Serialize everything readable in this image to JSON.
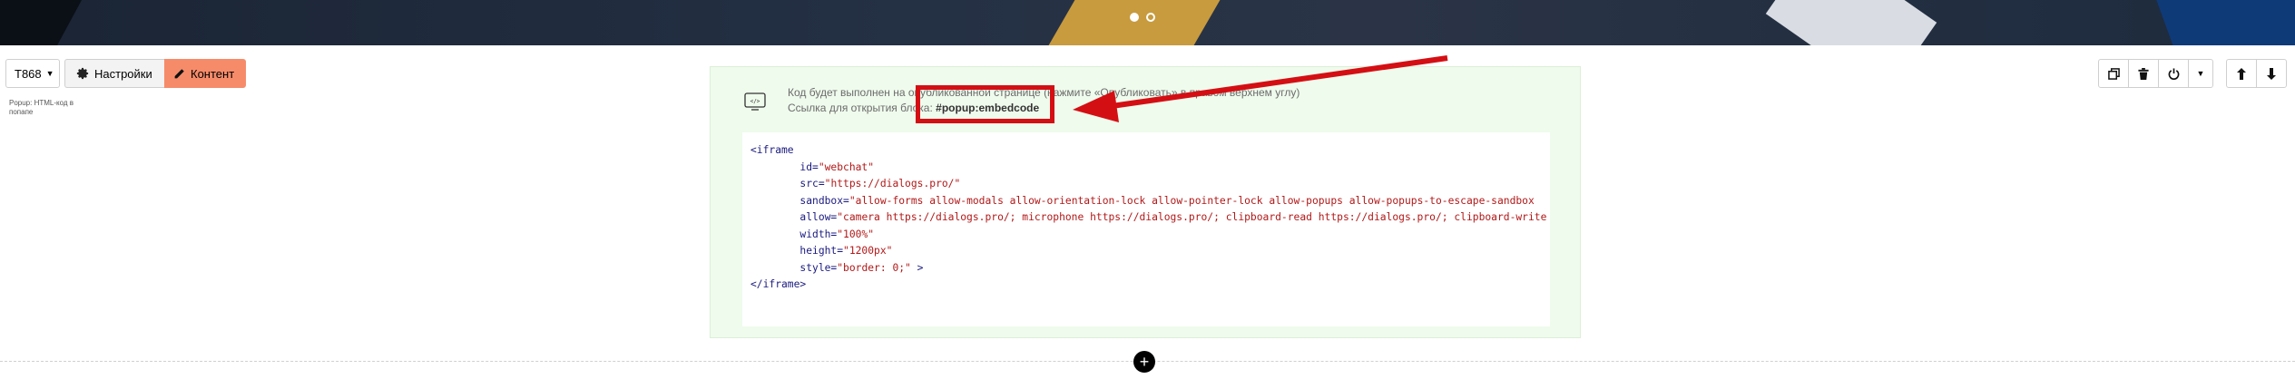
{
  "banner": {
    "slides": [
      {
        "state": "active"
      },
      {
        "state": "inactive"
      }
    ]
  },
  "toolbar": {
    "block_id": "T868",
    "settings_label": "Настройки",
    "content_label": "Контент",
    "block_description": "Popup: HTML-код в попапе"
  },
  "block": {
    "info_line1": "Код будет выполнен на опубликованной странице (нажмите «Опубликовать» в правом верхнем углу)",
    "info_link_label": "Ссылка для открытия блока:",
    "info_link_code": "#popup:embedcode"
  },
  "code": {
    "open_tag": "<iframe",
    "lines": [
      {
        "attr": "id=",
        "val": "\"webchat\""
      },
      {
        "attr": "src=",
        "val": "\"https://dialogs.pro/\""
      },
      {
        "attr": "sandbox=",
        "val": "\"allow-forms allow-modals allow-orientation-lock allow-pointer-lock allow-popups allow-popups-to-escape-sandbox"
      },
      {
        "attr": "allow=",
        "val": "\"camera https://dialogs.pro/; microphone https://dialogs.pro/; clipboard-read https://dialogs.pro/; clipboard-write"
      },
      {
        "attr": "width=",
        "val": "\"100%\""
      },
      {
        "attr": "height=",
        "val": "\"1200px\""
      },
      {
        "attr": "style=",
        "val": "\"border: 0;\"",
        "suffix": " >"
      }
    ],
    "close_tag": "</iframe>"
  },
  "colors": {
    "accent": "#f68b6a",
    "block_bg": "#effbec",
    "annotation": "#d40f14"
  },
  "icons": {
    "duplicate": "duplicate-icon",
    "delete": "trash-icon",
    "toggle": "power-icon",
    "more": "chevron-down-icon",
    "move_up": "arrow-up-icon",
    "move_down": "arrow-down-icon",
    "add": "plus-icon"
  }
}
